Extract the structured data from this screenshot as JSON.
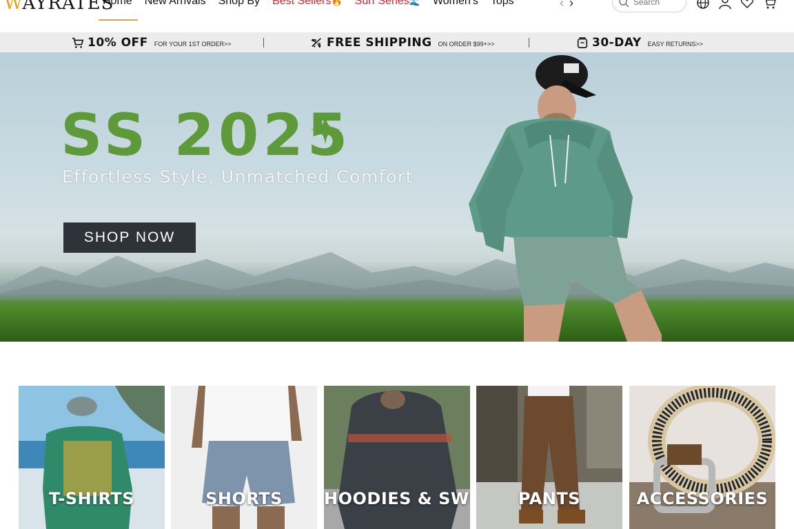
{
  "header": {
    "logo_text": "AYRATES",
    "logo_mark": "W",
    "nav": [
      {
        "label": "Home"
      },
      {
        "label": "New Arrivals"
      },
      {
        "label": "Shop By"
      },
      {
        "label": "Best Sellers",
        "emoji": "🔥"
      },
      {
        "label": "Surf Series",
        "emoji": "🌊"
      },
      {
        "label": "Women's"
      },
      {
        "label": "Tops"
      }
    ],
    "search_placeholder": "Search",
    "icons": [
      "globe-icon",
      "account-icon",
      "wishlist-icon",
      "cart-icon"
    ]
  },
  "promo": [
    {
      "big": "10% OFF",
      "small": "FOR YOUR 1ST ORDER>>",
      "icon": "cart-icon"
    },
    {
      "big": "FREE SHIPPING",
      "small": "ON ORDER $99+>>",
      "icon": "plane-icon"
    },
    {
      "big": "30-DAY",
      "small": "EASY RETURNS>>",
      "icon": "return-box-icon"
    }
  ],
  "hero": {
    "title": "SS 2025",
    "subtitle": "Effortless Style, Unmatched Comfort",
    "cta": "SHOP NOW"
  },
  "categories": [
    {
      "label": "T-SHIRTS"
    },
    {
      "label": "SHORTS"
    },
    {
      "label": "HOODIES & SWE..."
    },
    {
      "label": "PANTS"
    },
    {
      "label": "ACCESSORIES"
    }
  ],
  "colors": {
    "accent_red": "#e0202c",
    "hero_green": "#5f9a3a",
    "button_dark": "#2d3338",
    "promo_bg": "#ececec",
    "logo_orange": "#f39c12"
  }
}
